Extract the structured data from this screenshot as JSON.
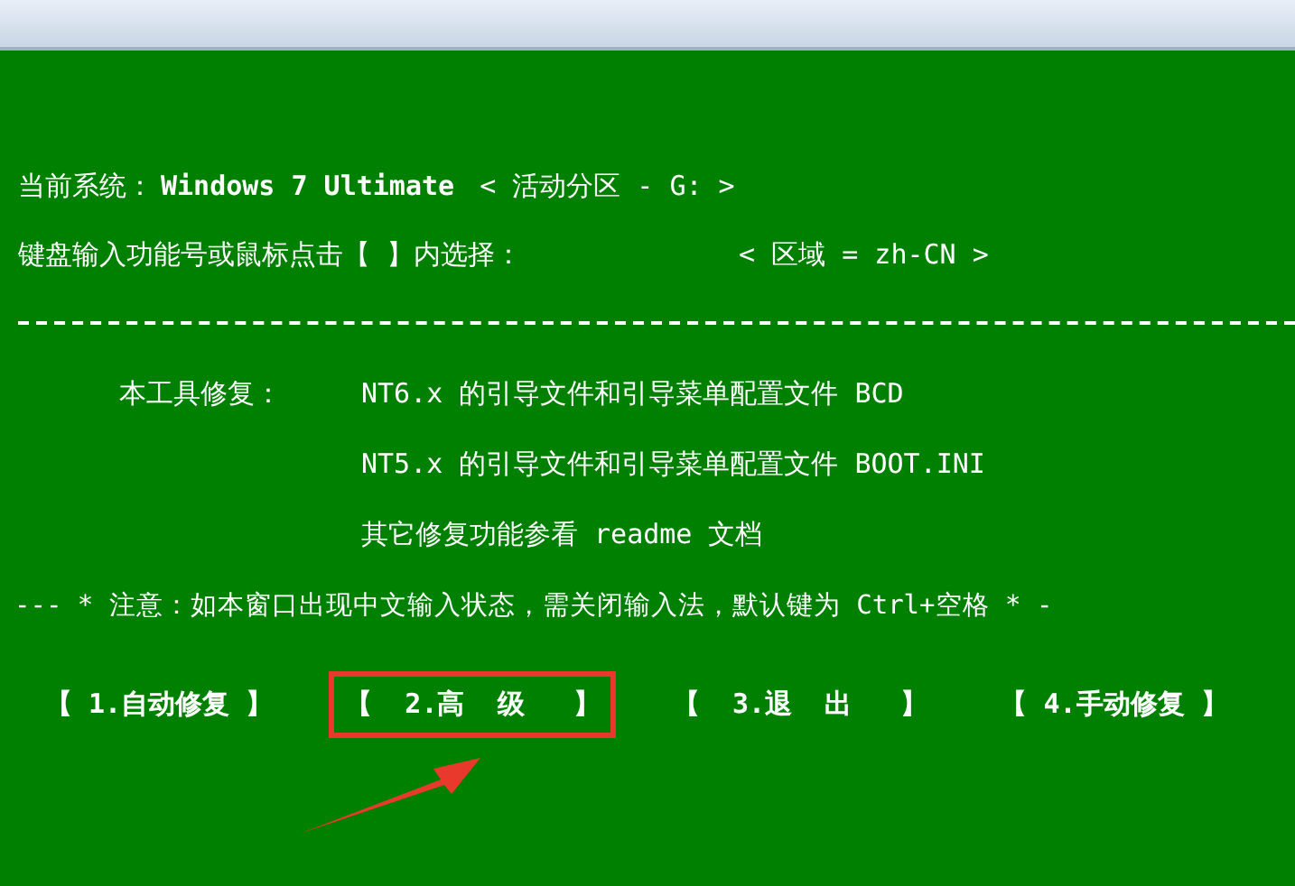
{
  "status_lines": [
    {
      "label": "当前系统：",
      "value": "Windows 7 Ultimate",
      "extra": "< 活动分区 - G: >"
    },
    {
      "label": "键盘输入功能号或鼠标点击【 】内选择：",
      "extra": "< 区域 = zh-CN >"
    }
  ],
  "repair_intro": {
    "label": "本工具修复：",
    "lines": [
      "NT6.x 的引导文件和引导菜单配置文件 BCD",
      "NT5.x 的引导文件和引导菜单配置文件 BOOT.INI",
      "其它修复功能参看 readme 文档"
    ]
  },
  "notice": "--- * 注意：如本窗口出现中文输入状态，需关闭输入法，默认键为 Ctrl+空格 * -",
  "menu": [
    {
      "label": "【 1.自动修复 】",
      "highlighted": false
    },
    {
      "label": "【  2.高  级   】",
      "highlighted": true
    },
    {
      "label": "【  3.退  出   】",
      "highlighted": false
    },
    {
      "label": "【 4.手动修复 】",
      "highlighted": false
    }
  ]
}
